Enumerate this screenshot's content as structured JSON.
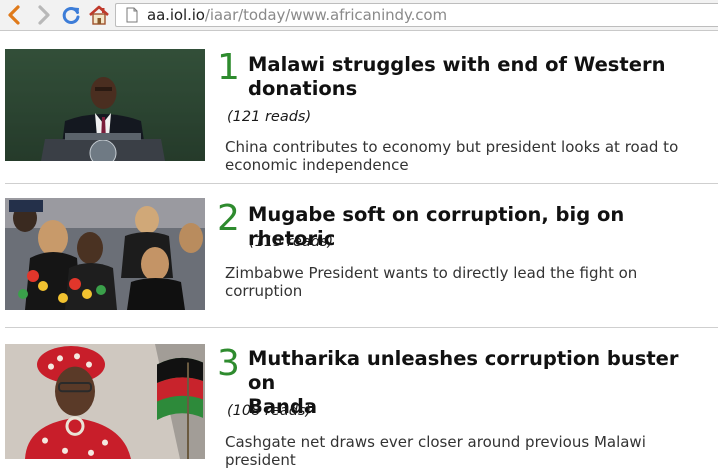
{
  "browser": {
    "url_host": "aa.iol.io",
    "url_path": "/iaar/today/www.africanindy.com"
  },
  "articles": [
    {
      "rank": "1",
      "title_lines": [
        "Malawi struggles with end of Western",
        "donations"
      ],
      "reads": "(121 reads)",
      "summary_lines": [
        "China contributes to economy but president looks at road to",
        "economic independence"
      ],
      "image": "malawi-president-podium-image"
    },
    {
      "rank": "2",
      "title_lines": [
        "Mugabe soft on corruption, big on rhetoric"
      ],
      "reads": "(115 reads)",
      "summary_lines": [
        "Zimbabwe President wants to directly lead the fight on corruption"
      ],
      "image": "mugabe-crowd-image"
    },
    {
      "rank": "3",
      "title_lines": [
        "Mutharika unleashes corruption buster on",
        "Banda"
      ],
      "reads": "(108 reads)",
      "summary_lines": [
        "Cashgate net draws ever closer around previous Malawi president"
      ],
      "image": "banda-with-flag-image"
    }
  ],
  "colors": {
    "rank": "#2e8b2e",
    "back_arrow": "#e07a1a",
    "reload": "#3d7dd8",
    "home": "#c0392b"
  }
}
